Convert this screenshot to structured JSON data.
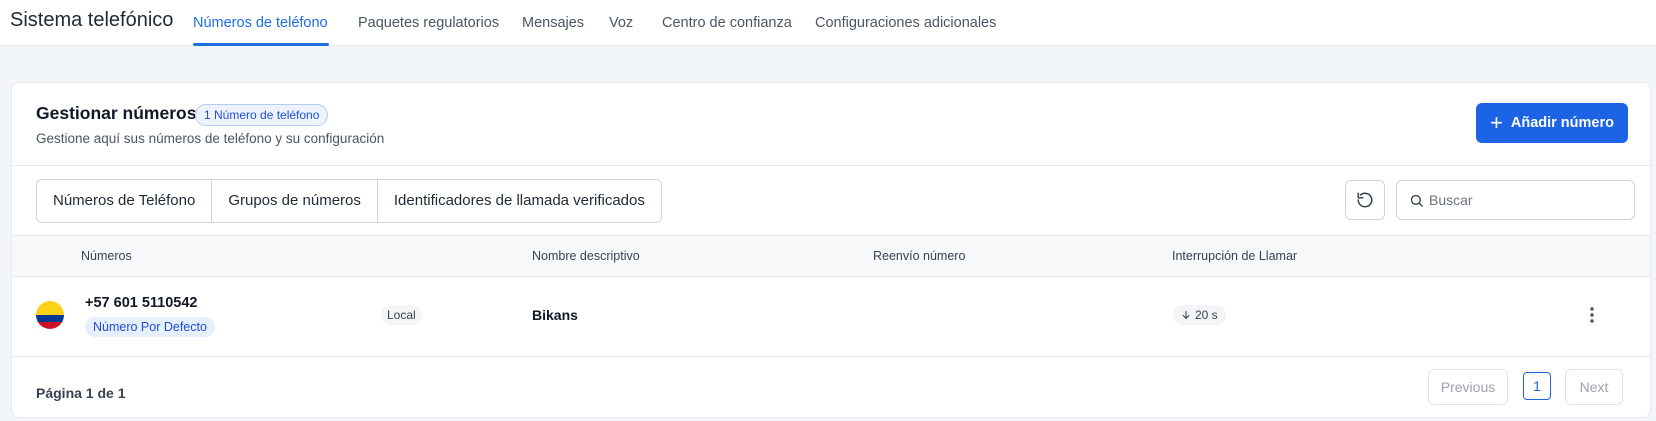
{
  "topbar": {
    "app_title": "Sistema telefónico",
    "tabs": [
      {
        "label": "Números de teléfono",
        "active": true
      },
      {
        "label": "Paquetes regulatorios",
        "active": false
      },
      {
        "label": "Mensajes",
        "active": false
      },
      {
        "label": "Voz",
        "active": false
      },
      {
        "label": "Centro de confianza",
        "active": false
      },
      {
        "label": "Configuraciones adicionales",
        "active": false
      }
    ]
  },
  "manage": {
    "title": "Gestionar números",
    "count_badge": "1 Número de teléfono",
    "subtitle": "Gestione aquí sus números de teléfono y su configuración",
    "add_button": "Añadir número"
  },
  "toolbar": {
    "segments": [
      "Números de Teléfono",
      "Grupos de números",
      "Identificadores de llamada verificados"
    ],
    "search_placeholder": "Buscar",
    "refresh_icon": "refresh-icon"
  },
  "table": {
    "headers": {
      "numbers": "Números",
      "friendly_name": "Nombre descriptivo",
      "forwarding": "Reenvío número",
      "call_timeout": "Interrupción de Llamar"
    },
    "rows": [
      {
        "flag": "colombia-flag-icon",
        "number": "+57 601 5110542",
        "default_badge": "Número Por Defecto",
        "type": "Local",
        "friendly_name": "Bikans",
        "forwarding": "",
        "timeout": "20 s"
      }
    ]
  },
  "pagination": {
    "label": "Página 1 de 1",
    "previous": "Previous",
    "current_page": "1",
    "next": "Next"
  },
  "colors": {
    "accent": "#1d63e6",
    "flag_yellow": "#fcd116",
    "flag_blue": "#003893",
    "flag_red": "#ce1126"
  }
}
